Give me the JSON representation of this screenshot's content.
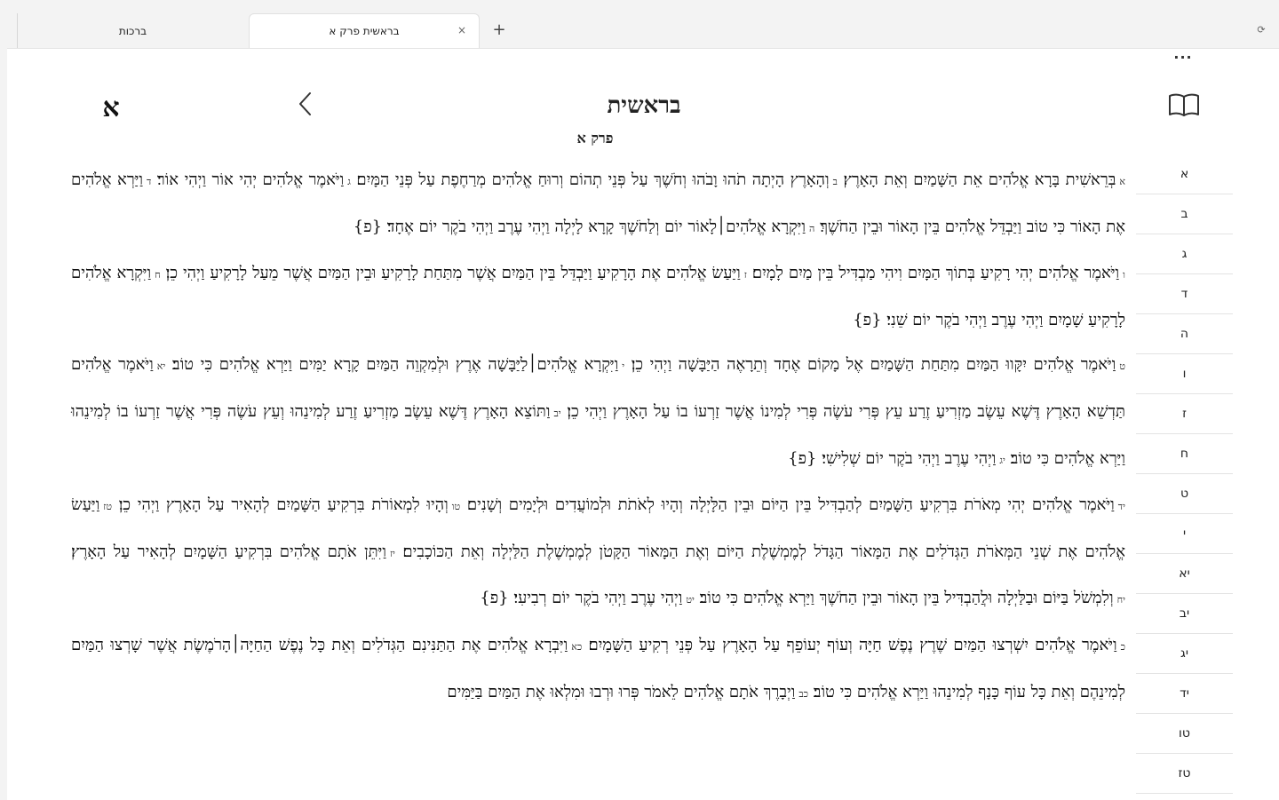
{
  "tabs": [
    {
      "label": "ברכות",
      "active": false
    },
    {
      "label": "בראשית פרק א",
      "active": true,
      "close": "×"
    }
  ],
  "new_tab_label": "+",
  "window_button_glyph": "⟳",
  "more_label": "...",
  "header": {
    "title": "בראשית",
    "subtitle": "פרק א",
    "chapter_letter": "א"
  },
  "colors": {
    "accent": "#1b1b1b",
    "background": "#ffffff",
    "tabbar": "#f3f3f3"
  },
  "paragraphs": [
    [
      {
        "num": "א",
        "text": "בְּרֵאשִׁית בָּרָא אֱלֹהִים אֵת הַשָּׁמַיִם וְאֵת הָאָרֶץ׃"
      },
      {
        "num": "ב",
        "text": "וְהָאָרֶץ הָיְתָה תֹהוּ וָבֹהוּ וְחֹשֶׁךְ עַל פְּנֵי תְהוֹם וְרוּחַ אֱלֹהִים מְרַחֶפֶת עַל פְּנֵי הַמָּיִם׃"
      },
      {
        "num": "ג",
        "text": "וַיֹּאמֶר אֱלֹהִים יְהִי אוֹר וַיְהִי אוֹר׃"
      },
      {
        "num": "ד",
        "text": "וַיַּרְא אֱלֹהִים אֶת הָאוֹר כִּי טוֹב וַיַּבְדֵּל אֱלֹהִים בֵּין הָאוֹר וּבֵין הַחֹשֶׁךְ׃"
      },
      {
        "num": "ה",
        "text": "וַיִּקְרָא אֱלֹהִים׀לָאוֹר יוֹם וְלַחֹשֶׁךְ קָרָא לָיְלָה וַיְהִי עֶרֶב וַיְהִי בֹקֶר יוֹם אֶחָד׃ {פ}"
      }
    ],
    [
      {
        "num": "ו",
        "text": "וַיֹּאמֶר אֱלֹהִים יְהִי רָקִיעַ בְּתוֹךְ הַמָּיִם וִיהִי מַבְדִּיל בֵּין מַיִם לָמָיִם׃"
      },
      {
        "num": "ז",
        "text": "וַיַּעַשׂ אֱלֹהִים אֶת הָרָקִיעַ וַיַּבְדֵּל בֵּין הַמַּיִם אֲשֶׁר מִתַּחַת לָרָקִיעַ וּבֵין הַמַּיִם אֲשֶׁר מֵעַל לָרָקִיעַ וַיְהִי כֵן׃"
      },
      {
        "num": "ח",
        "text": "וַיִּקְרָא אֱלֹהִים לָרָקִיעַ שָׁמָיִם וַיְהִי עֶרֶב וַיְהִי בֹקֶר יוֹם שֵׁנִי׃ {פ}"
      }
    ],
    [
      {
        "num": "ט",
        "text": "וַיֹּאמֶר אֱלֹהִים יִקָּווּ הַמַּיִם מִתַּחַת הַשָּׁמַיִם אֶל מָקוֹם אֶחָד וְתֵרָאֶה הַיַּבָּשָׁה וַיְהִי כֵן׃"
      },
      {
        "num": "י",
        "text": "וַיִּקְרָא אֱלֹהִים׀לַיַּבָּשָׁה אֶרֶץ וּלְמִקְוֵה הַמַּיִם קָרָא יַמִּים וַיַּרְא אֱלֹהִים כִּי טוֹב׃"
      },
      {
        "num": "יא",
        "text": "וַיֹּאמֶר אֱלֹהִים תַּדְשֵׁא הָאָרֶץ דֶּשֶׁא עֵשֶׂב מַזְרִיעַ זֶרַע עֵץ פְּרִי עֹשֶׂה פְּרִי לְמִינוֹ אֲשֶׁר זַרְעוֹ בוֹ עַל הָאָרֶץ וַיְהִי כֵן׃"
      },
      {
        "num": "יב",
        "text": "וַתּוֹצֵא הָאָרֶץ דֶּשֶׁא עֵשֶׂב מַזְרִיעַ זֶרַע לְמִינֵהוּ וְעֵץ עֹשֶׂה פְּרִי אֲשֶׁר זַרְעוֹ בוֹ לְמִינֵהוּ וַיַּרְא אֱלֹהִים כִּי טוֹב׃"
      },
      {
        "num": "יג",
        "text": "וַיְהִי עֶרֶב וַיְהִי בֹקֶר יוֹם שְׁלִישִׁי׃ {פ}"
      }
    ],
    [
      {
        "num": "יד",
        "text": "וַיֹּאמֶר אֱלֹהִים יְהִי מְאֹרֹת בִּרְקִיעַ הַשָּׁמַיִם לְהַבְדִּיל בֵּין הַיּוֹם וּבֵין הַלָּיְלָה וְהָיוּ לְאֹתֹת וּלְמוֹעֲדִים וּלְיָמִים וְשָׁנִים׃"
      },
      {
        "num": "טו",
        "text": "וְהָיוּ לִמְאוֹרֹת בִּרְקִיעַ הַשָּׁמַיִם לְהָאִיר עַל הָאָרֶץ וַיְהִי כֵן׃"
      },
      {
        "num": "טז",
        "text": "וַיַּעַשׂ אֱלֹהִים אֶת שְׁנֵי הַמְּאֹרֹת הַגְּדֹלִים אֶת הַמָּאוֹר הַגָּדֹל לְמֶמְשֶׁלֶת הַיּוֹם וְאֶת הַמָּאוֹר הַקָּטֹן לְמֶמְשֶׁלֶת הַלַּיְלָה וְאֵת הַכּוֹכָבִים׃"
      },
      {
        "num": "יז",
        "text": "וַיִּתֵּן אֹתָם אֱלֹהִים בִּרְקִיעַ הַשָּׁמָיִם לְהָאִיר עַל הָאָרֶץ׃"
      },
      {
        "num": "יח",
        "text": "וְלִמְשֹׁל בַּיּוֹם וּבַלַּיְלָה וּלֲהַבְדִּיל בֵּין הָאוֹר וּבֵין הַחֹשֶׁךְ וַיַּרְא אֱלֹהִים כִּי טוֹב׃"
      },
      {
        "num": "יט",
        "text": "וַיְהִי עֶרֶב וַיְהִי בֹקֶר יוֹם רְבִיעִי׃ {פ}"
      }
    ],
    [
      {
        "num": "כ",
        "text": "וַיֹּאמֶר אֱלֹהִים יִשְׁרְצוּ הַמַּיִם שֶׁרֶץ נֶפֶשׁ חַיָּה וְעוֹף יְעוֹפֵף עַל הָאָרֶץ עַל פְּנֵי רְקִיעַ הַשָּׁמָיִם׃"
      },
      {
        "num": "כא",
        "text": "וַיִּבְרָא אֱלֹהִים אֶת הַתַּנִּינִם הַגְּדֹלִים וְאֵת כָּל נֶפֶשׁ הַחַיָּה׀הָרֹמֶשֶׂת אֲשֶׁר שָׁרְצוּ הַמַּיִם לְמִינֵהֶם וְאֵת כָּל עוֹף כָּנָף לְמִינֵהוּ וַיַּרְא אֱלֹהִים כִּי טוֹב׃"
      },
      {
        "num": "כב",
        "text": "וַיְבָרֶךְ אֹתָם אֱלֹהִים לֵאמֹר פְּרוּ וּרְבוּ וּמִלְאוּ אֶת הַמַּיִם בַּיַּמִּים"
      }
    ]
  ],
  "chapters": [
    "א",
    "ב",
    "ג",
    "ד",
    "ה",
    "ו",
    "ז",
    "ח",
    "ט",
    "י",
    "יא",
    "יב",
    "יג",
    "יד",
    "טו",
    "טז"
  ]
}
